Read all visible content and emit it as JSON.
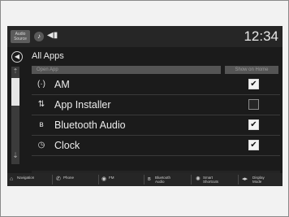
{
  "status": {
    "source_label": "Audio Source",
    "source_icon": "media-icon",
    "volume_icon": "speaker-icon",
    "time": "12:34"
  },
  "title": "All Apps",
  "columns": {
    "open_app": "Open App",
    "show_on_home": "Show on Home"
  },
  "apps": [
    {
      "icon": "(·)",
      "icon_name": "radio-icon",
      "label": "AM",
      "show_on_home": true
    },
    {
      "icon": "⇅",
      "icon_name": "app-installer-icon",
      "label": "App Installer",
      "show_on_home": false
    },
    {
      "icon": "ʙ",
      "icon_name": "bluetooth-icon",
      "label": "Bluetooth Audio",
      "show_on_home": true
    },
    {
      "icon": "◷",
      "icon_name": "clock-icon",
      "label": "Clock",
      "show_on_home": true
    }
  ],
  "nav": [
    {
      "icon": "⌂",
      "icon_name": "navigation-icon",
      "label": "Navigation"
    },
    {
      "icon": "✆",
      "icon_name": "phone-icon",
      "label": "Phone"
    },
    {
      "icon": "◉",
      "icon_name": "fm-icon",
      "label": "FM"
    },
    {
      "icon": "ʙ",
      "icon_name": "bluetooth-icon",
      "label": "Bluetooth Audio"
    },
    {
      "icon": "✺",
      "icon_name": "smart-shortcuts-icon",
      "label": "Smart Shortcuts"
    },
    {
      "icon": "◂▸",
      "icon_name": "display-mode-icon",
      "label": "Display Mode"
    }
  ],
  "colors": {
    "screen_bg": "#1b1b1b",
    "bar_bg": "#262626",
    "header_bg": "#555555",
    "text": "#ececec"
  }
}
